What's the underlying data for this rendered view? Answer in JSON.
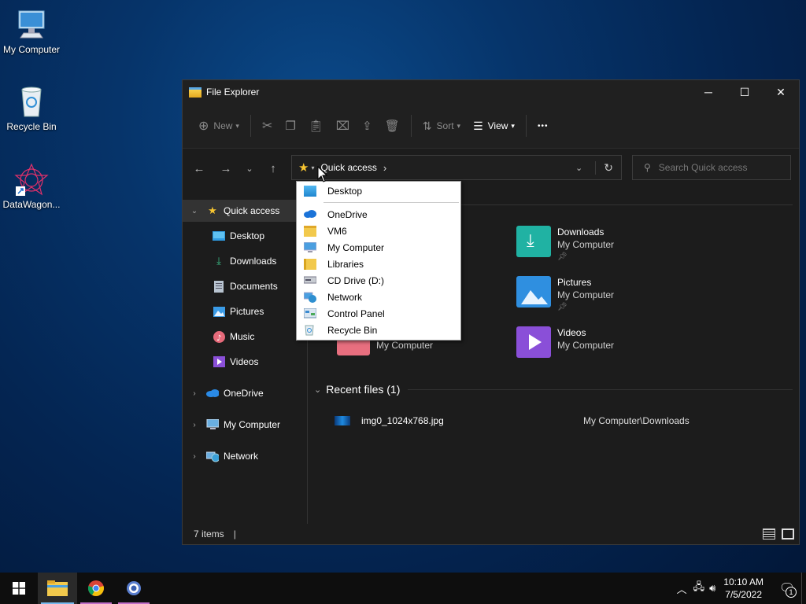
{
  "desktop": {
    "icons": [
      {
        "label": "My Computer",
        "icon": "computer-icon"
      },
      {
        "label": "Recycle Bin",
        "icon": "recycle-bin-icon"
      },
      {
        "label": "DataWagon...",
        "icon": "datawagon-shortcut-icon"
      }
    ]
  },
  "window": {
    "title": "File Explorer",
    "controls": {
      "minimize": "─",
      "maximize": "☐",
      "close": "✕"
    }
  },
  "command_bar": {
    "new_label": "New",
    "sort_label": "Sort",
    "view_label": "View",
    "more_label": "•••"
  },
  "address_bar": {
    "location": "Quick access",
    "separator": "›"
  },
  "search": {
    "placeholder": "Search Quick access"
  },
  "nav_pane": {
    "quick_access": "Quick access",
    "quick_items": [
      "Desktop",
      "Downloads",
      "Documents",
      "Pictures",
      "Music",
      "Videos"
    ],
    "onedrive": "OneDrive",
    "my_computer": "My Computer",
    "network": "Network"
  },
  "content": {
    "folders": [
      {
        "name": "Downloads",
        "location": "My Computer",
        "color": "#20b2a3"
      },
      {
        "name": "Pictures",
        "location": "My Computer",
        "color": "#2f8fe0"
      },
      {
        "name": "Videos",
        "location": "My Computer",
        "color": "#8a4fd8"
      }
    ],
    "partial_location": "My Computer",
    "recent_header": "Recent files (1)",
    "recent_files": [
      {
        "name": "img0_1024x768.jpg",
        "path": "My Computer\\Downloads"
      }
    ]
  },
  "status_bar": {
    "items": "7 items"
  },
  "dropdown": {
    "items": [
      "Desktop",
      "OneDrive",
      "VM6",
      "My Computer",
      "Libraries",
      "CD Drive (D:)",
      "Network",
      "Control Panel",
      "Recycle Bin"
    ]
  },
  "taskbar": {
    "time": "10:10 AM",
    "date": "7/5/2022",
    "notification_count": "1"
  },
  "colors": {
    "accent": "#76b9ed",
    "folder_yellow": "#f2c94c",
    "star": "#f7c531"
  }
}
